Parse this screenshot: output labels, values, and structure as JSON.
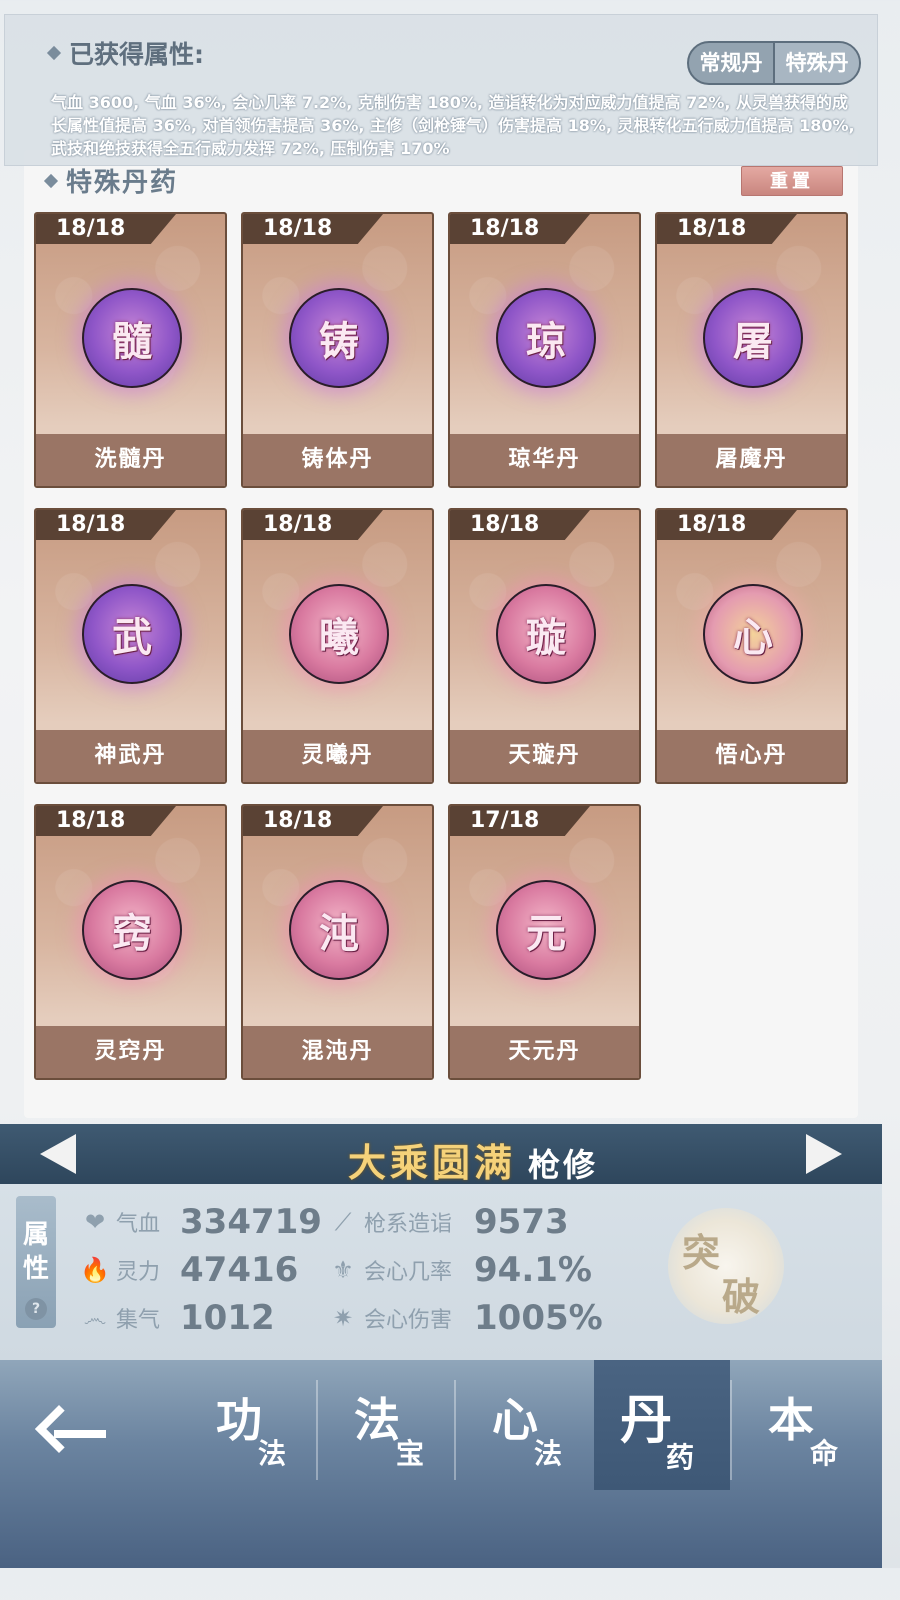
{
  "attributes": {
    "title": "已获得属性:",
    "text": "气血 3600, 气血 36%, 会心几率 7.2%, 克制伤害 180%, 造诣转化为对应威力值提高 72%, 从灵兽获得的成长属性值提高 36%, 对首领伤害提高 36%, 主修（剑枪锤气）伤害提高 18%, 灵根转化五行威力值提高 180%, 武技和绝技获得全五行威力发挥 72%, 压制伤害 170%",
    "toggle": [
      "常规丹",
      "特殊丹"
    ]
  },
  "section": {
    "title": "特殊丹药",
    "reset_label": "重置"
  },
  "pills": [
    {
      "count": "18/18",
      "glyph": "髓",
      "name": "洗髓丹",
      "color": "purple"
    },
    {
      "count": "18/18",
      "glyph": "铸",
      "name": "铸体丹",
      "color": "purple"
    },
    {
      "count": "18/18",
      "glyph": "琼",
      "name": "琼华丹",
      "color": "purple"
    },
    {
      "count": "18/18",
      "glyph": "屠",
      "name": "屠魔丹",
      "color": "purple"
    },
    {
      "count": "18/18",
      "glyph": "武",
      "name": "神武丹",
      "color": "purple"
    },
    {
      "count": "18/18",
      "glyph": "曦",
      "name": "灵曦丹",
      "color": "pink"
    },
    {
      "count": "18/18",
      "glyph": "璇",
      "name": "天璇丹",
      "color": "pink"
    },
    {
      "count": "18/18",
      "glyph": "心",
      "name": "悟心丹",
      "color": "gold"
    },
    {
      "count": "18/18",
      "glyph": "窍",
      "name": "灵窍丹",
      "color": "pink"
    },
    {
      "count": "18/18",
      "glyph": "沌",
      "name": "混沌丹",
      "color": "pink"
    },
    {
      "count": "17/18",
      "glyph": "元",
      "name": "天元丹",
      "color": "pink"
    }
  ],
  "realm": {
    "title": "大乘圆满",
    "subtitle": "枪修"
  },
  "stats": {
    "tag": [
      "属",
      "性"
    ],
    "help": "?",
    "items": [
      {
        "icon": "heart-icon",
        "label": "气血",
        "value": "334719"
      },
      {
        "icon": "spirit-flame-icon",
        "label": "灵力",
        "value": "47416"
      },
      {
        "icon": "swirl-icon",
        "label": "集气",
        "value": "1012"
      },
      {
        "icon": "spear-icon",
        "label": "枪系造诣",
        "value": "9573"
      },
      {
        "icon": "crit-rate-icon",
        "label": "会心几率",
        "value": "94.1%"
      },
      {
        "icon": "crit-damage-icon",
        "label": "会心伤害",
        "value": "1005%"
      }
    ],
    "breakthrough": [
      "突",
      "破"
    ]
  },
  "nav": [
    {
      "c1": "功",
      "c2": "法"
    },
    {
      "c1": "法",
      "c2": "宝"
    },
    {
      "c1": "心",
      "c2": "法"
    },
    {
      "c1": "丹",
      "c2": "药"
    },
    {
      "c1": "本",
      "c2": "命"
    }
  ]
}
